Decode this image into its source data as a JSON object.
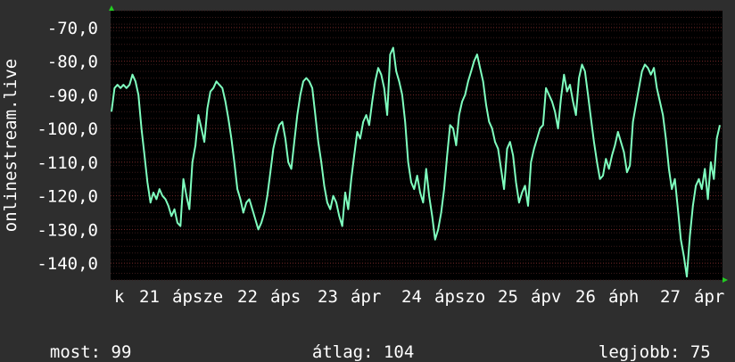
{
  "chart_data": {
    "type": "line",
    "ylabel": "onlinestream.live",
    "ylim": [
      -145,
      -65
    ],
    "y_ticks": [
      -70,
      -80,
      -90,
      -100,
      -110,
      -120,
      -130,
      -140
    ],
    "y_tick_labels": [
      "-70,0",
      "-80,0",
      "-90,0",
      "-100,0",
      "-110,0",
      "-120,0",
      "-130,0",
      "-140,0"
    ],
    "grid": true,
    "x_tick_labels": [
      "k",
      "21",
      "ápsze",
      "22",
      "áps",
      "23",
      "ápr",
      "24",
      "ápszo",
      "25",
      "ápv",
      "26",
      "áph",
      "27",
      "ápr"
    ],
    "series": [
      {
        "color": "#7fffbf",
        "values": [
          -95,
          -88,
          -87,
          -88,
          -87,
          -88,
          -87,
          -84,
          -86,
          -90,
          -100,
          -108,
          -116,
          -122,
          -119,
          -121,
          -118,
          -120,
          -121,
          -123,
          -126,
          -124,
          -128,
          -129,
          -115,
          -120,
          -124,
          -110,
          -105,
          -96,
          -100,
          -104,
          -94,
          -89,
          -88,
          -86,
          -87,
          -88,
          -92,
          -97,
          -103,
          -110,
          -118,
          -121,
          -125,
          -122,
          -121,
          -124,
          -127,
          -130,
          -128,
          -125,
          -120,
          -113,
          -106,
          -102,
          -99,
          -98,
          -103,
          -110,
          -112,
          -104,
          -96,
          -90,
          -86,
          -85,
          -86,
          -88,
          -96,
          -104,
          -110,
          -117,
          -122,
          -124,
          -120,
          -122,
          -126,
          -129,
          -119,
          -124,
          -115,
          -108,
          -101,
          -103,
          -98,
          -96,
          -99,
          -92,
          -86,
          -82,
          -84,
          -88,
          -96,
          -78,
          -76,
          -83,
          -86,
          -90,
          -98,
          -110,
          -116,
          -118,
          -114,
          -119,
          -122,
          -112,
          -120,
          -126,
          -133,
          -130,
          -125,
          -118,
          -108,
          -99,
          -100,
          -105,
          -96,
          -92,
          -90,
          -86,
          -83,
          -80,
          -78,
          -82,
          -86,
          -93,
          -98,
          -100,
          -104,
          -106,
          -112,
          -118,
          -106,
          -104,
          -108,
          -116,
          -122,
          -119,
          -117,
          -123,
          -110,
          -106,
          -103,
          -100,
          -99,
          -88,
          -90,
          -92,
          -95,
          -100,
          -91,
          -84,
          -89,
          -87,
          -92,
          -96,
          -85,
          -81,
          -83,
          -90,
          -97,
          -104,
          -110,
          -115,
          -114,
          -109,
          -112,
          -108,
          -105,
          -101,
          -104,
          -107,
          -113,
          -111,
          -98,
          -93,
          -88,
          -83,
          -81,
          -82,
          -84,
          -82,
          -88,
          -92,
          -96,
          -103,
          -112,
          -118,
          -115,
          -124,
          -133,
          -138,
          -144,
          -132,
          -123,
          -117,
          -115,
          -118,
          -112,
          -121,
          -110,
          -115,
          -103,
          -99
        ]
      }
    ],
    "legend_stats": [
      {
        "label": "most:",
        "value": "99"
      },
      {
        "label": "átlag:",
        "value": "104"
      },
      {
        "label": "legjobb:",
        "value": "75"
      }
    ]
  }
}
